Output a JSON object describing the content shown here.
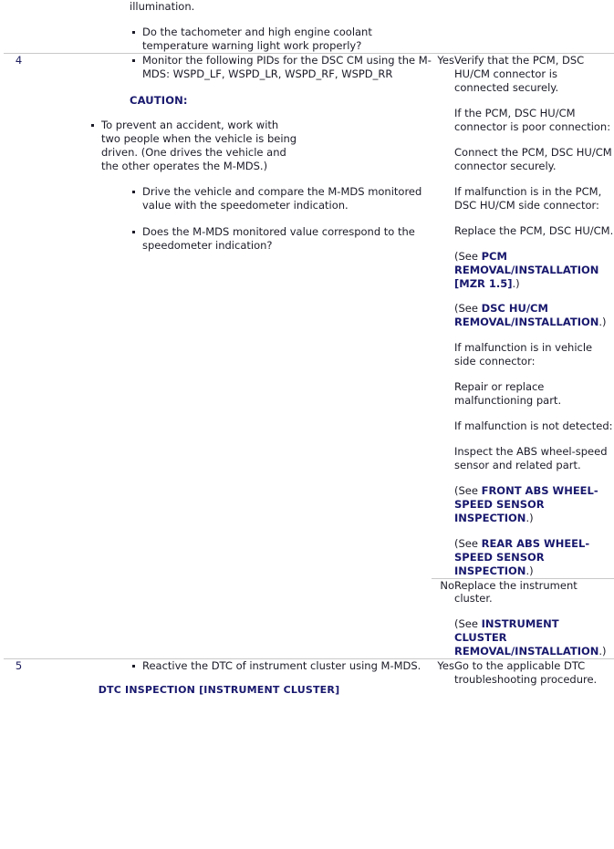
{
  "document": {
    "type": "service-manual-troubleshooting-table",
    "colors": {
      "body_text": "#1b1b28",
      "reference_link": "#18186e",
      "caution_heading": "#18186e",
      "table_rule": "#c9c9c9",
      "background": "#ffffff"
    }
  },
  "columns": {
    "step_number": "",
    "inspection": "",
    "result": "",
    "action": ""
  },
  "rows": [
    {
      "number": "",
      "inspection": {
        "continued_text": "illumination.",
        "bullets": [
          "Do the tachometer and high engine coolant temperature warning light work properly?"
        ]
      },
      "result": "",
      "action": ""
    },
    {
      "number": "4",
      "inspection": {
        "bullets": [
          "Monitor the following PIDs for the DSC CM using the M-MDS: WSPD_LF, WSPD_LR, WSPD_RF, WSPD_RR"
        ],
        "caution_label": "CAUTION:",
        "caution_bullets": [
          "To prevent an accident, work with two people when the vehicle is being driven. (One drives the vehicle and the other operates the M-MDS.)"
        ],
        "bullets_after": [
          "Drive the vehicle and compare the M-MDS monitored value with the speedometer indication.",
          "Does the M-MDS monitored value correspond to the speedometer indication?"
        ]
      },
      "results": [
        {
          "label": "Yes",
          "action_paragraphs": [
            "Verify that the PCM, DSC HU/CM connector is connected securely.",
            "If the PCM, DSC HU/CM connector is poor connection:",
            "Connect the PCM, DSC HU/CM connector securely.",
            "If malfunction is in the PCM, DSC HU/CM side connector:",
            "Replace the PCM, DSC HU/CM."
          ],
          "references": [
            {
              "prefix": "(See ",
              "link": "PCM REMOVAL/INSTALLATION [MZR 1.5]",
              "suffix": ".)"
            },
            {
              "prefix": "(See ",
              "link": "DSC HU/CM REMOVAL/INSTALLATION",
              "suffix": ".)"
            }
          ],
          "action_paragraphs_2": [
            "If malfunction is in vehicle side connector:",
            "Repair or replace malfunctioning part.",
            "If malfunction is not detected:",
            "Inspect the ABS wheel-speed sensor and related part."
          ],
          "references_2": [
            {
              "prefix": "(See ",
              "link": "FRONT ABS WHEEL-SPEED SENSOR INSPECTION",
              "suffix": ".)"
            },
            {
              "prefix": "(See ",
              "link": "REAR ABS WHEEL-SPEED SENSOR INSPECTION",
              "suffix": ".)"
            }
          ]
        },
        {
          "label": "No",
          "action_paragraphs": [
            "Replace the instrument cluster."
          ],
          "references": [
            {
              "prefix": "(See ",
              "link": "INSTRUMENT CLUSTER REMOVAL/INSTALLATION",
              "suffix": ".)"
            }
          ]
        }
      ]
    },
    {
      "number": "5",
      "inspection": {
        "bullets": [
          "Reactive the DTC of instrument cluster using M-MDS."
        ],
        "centered_reference": "DTC INSPECTION [INSTRUMENT CLUSTER]"
      },
      "results": [
        {
          "label": "Yes",
          "action_paragraphs": [
            "Go to the applicable DTC troubleshooting procedure."
          ]
        }
      ]
    }
  ]
}
